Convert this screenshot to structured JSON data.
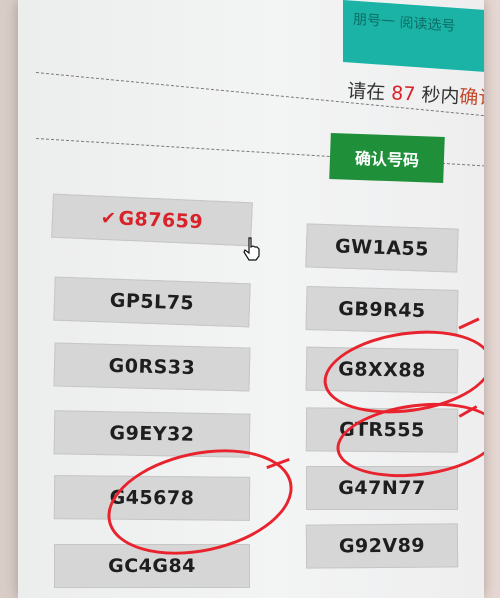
{
  "header": {
    "topbar_text": "朋号一 阅读选号",
    "prompt_prefix": "请在",
    "countdown": "87",
    "prompt_suffix": "秒内",
    "prompt_tail": "确认号",
    "confirm_label": "确认号码"
  },
  "left_options": [
    {
      "label": "G87659",
      "selected": true
    },
    {
      "label": "GP5L75"
    },
    {
      "label": "G0RS33"
    },
    {
      "label": "G9EY32"
    },
    {
      "label": "G45678",
      "circled": true
    },
    {
      "label": "GC4G84"
    }
  ],
  "right_options": [
    {
      "label": "GW1A55"
    },
    {
      "label": "GB9R45"
    },
    {
      "label": "G8XX88",
      "circled": true
    },
    {
      "label": "GTR555",
      "circled": true
    },
    {
      "label": "G47N77"
    },
    {
      "label": "G92V89"
    }
  ],
  "colors": {
    "accent_red": "#d8232a",
    "confirm_green": "#1f8f3a",
    "topbar_teal": "#1ab3a6"
  }
}
